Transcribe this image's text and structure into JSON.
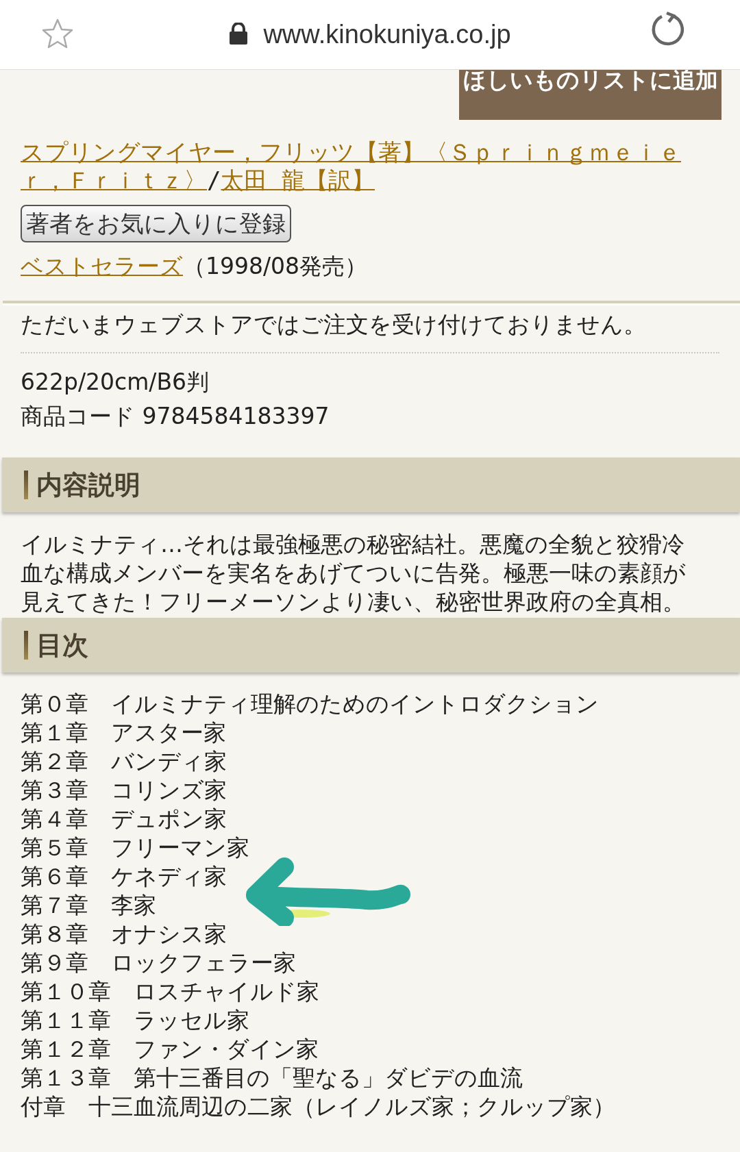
{
  "browser": {
    "url": "www.kinokuniya.co.jp",
    "secure": true
  },
  "wishlist_button": "ほしいものリストに追加",
  "authors": [
    {
      "name_lines": [
        "スプリングマイヤー，フリッツ【著】〈Ｓｐｒｉｎｇｍｅｉｅ",
        "ｒ，Ｆｒｉｔｚ〉"
      ]
    },
    {
      "name_lines": [
        "太田 龍【訳】"
      ]
    }
  ],
  "author_separator": "/",
  "favorite_author_button": "著者をお気に入りに登録",
  "publisher": {
    "name": "ベストセラーズ",
    "release": "（1998/08発売）"
  },
  "order_notice": "ただいまウェブストアではご注文を受け付けておりません。",
  "specs": [
    "622p/20cm/B6判",
    "商品コード 9784584183397"
  ],
  "sections": [
    {
      "kind": "description",
      "title": "内容説明",
      "text": "イルミナティ…それは最強極悪の秘密結社。悪魔の全貌と狡猾冷血な構成メンバーを実名をあげてついに告発。極悪一味の素顔が見えてきた！フリーメーソンより凄い、秘密世界政府の全真相。"
    },
    {
      "kind": "contents",
      "title": "目次",
      "items": [
        "第０章　イルミナティ理解のためのイントロダクション",
        "第１章　アスター家",
        "第２章　バンディ家",
        "第３章　コリンズ家",
        "第４章　デュポン家",
        "第５章　フリーマン家",
        "第６章　ケネディ家",
        "第７章　李家",
        "第８章　オナシス家",
        "第９章　ロックフェラー家",
        "第１０章　ロスチャイルド家",
        "第１１章　ラッセル家",
        "第１２章　ファン・ダイン家",
        "第１３章　第十三番目の「聖なる」ダビデの血流",
        "付章　十三血流周辺の二家（レイノルズ家；クルップ家）"
      ]
    }
  ]
}
